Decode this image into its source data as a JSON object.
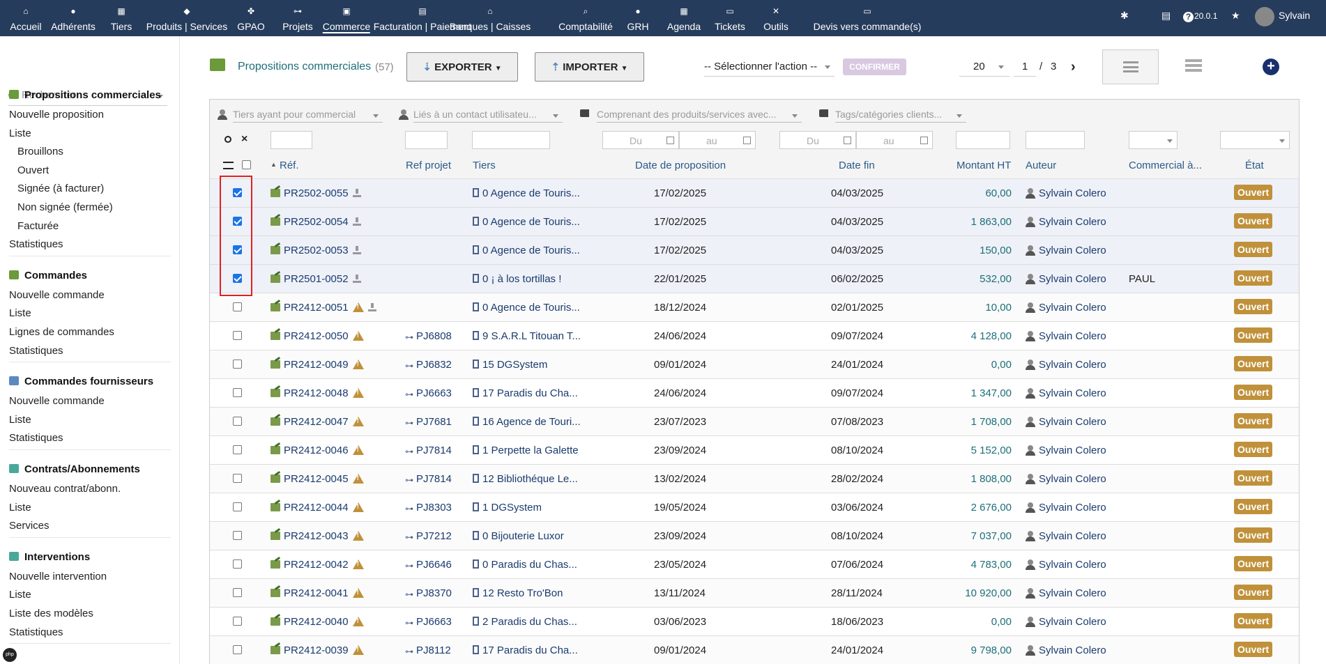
{
  "topnav": {
    "items": [
      {
        "label": "Accueil",
        "icon": "home-icon",
        "active": false
      },
      {
        "label": "Adhérents",
        "icon": "user-icon",
        "active": false
      },
      {
        "label": "Tiers",
        "icon": "building-icon",
        "active": false
      },
      {
        "label": "Produits | Services",
        "icon": "cube-icon",
        "active": false
      },
      {
        "label": "GPAO",
        "icon": "cubes-icon",
        "active": false
      },
      {
        "label": "Projets",
        "icon": "sitemap-icon",
        "active": false
      },
      {
        "label": "Commerce",
        "icon": "briefcase-icon",
        "active": true
      },
      {
        "label": "Facturation | Paiement",
        "icon": "file-invoice-icon",
        "active": false
      },
      {
        "label": "Banques | Caisses",
        "icon": "bank-icon",
        "active": false
      },
      {
        "label": "Comptabilité",
        "icon": "search-dollar-icon",
        "active": false
      },
      {
        "label": "GRH",
        "icon": "user-tie-icon",
        "active": false
      },
      {
        "label": "Agenda",
        "icon": "calendar-icon",
        "active": false
      },
      {
        "label": "Tickets",
        "icon": "ticket-icon",
        "active": false
      },
      {
        "label": "Outils",
        "icon": "tools-icon",
        "active": false
      },
      {
        "label": "Devis vers commande(s)",
        "icon": "file-icon",
        "active": false
      }
    ],
    "version": "20.0.1",
    "user": "Sylvain"
  },
  "sidebar": {
    "search_placeholder": "Rechercher",
    "sections": [
      {
        "title": "Propositions commerciales",
        "icon_color": "#6a9a3a",
        "items": [
          {
            "label": "Nouvelle proposition",
            "sub": false
          },
          {
            "label": "Liste",
            "sub": false
          },
          {
            "label": "Brouillons",
            "sub": true
          },
          {
            "label": "Ouvert",
            "sub": true
          },
          {
            "label": "Signée (à facturer)",
            "sub": true
          },
          {
            "label": "Non signée (fermée)",
            "sub": true
          },
          {
            "label": "Facturée",
            "sub": true
          },
          {
            "label": "Statistiques",
            "sub": false
          }
        ]
      },
      {
        "title": "Commandes",
        "icon_color": "#6a9a3a",
        "items": [
          {
            "label": "Nouvelle commande",
            "sub": false
          },
          {
            "label": "Liste",
            "sub": false
          },
          {
            "label": "Lignes de commandes",
            "sub": false
          },
          {
            "label": "Statistiques",
            "sub": false
          }
        ]
      },
      {
        "title": "Commandes fournisseurs",
        "icon_color": "#5a8abf",
        "items": [
          {
            "label": "Nouvelle commande",
            "sub": false
          },
          {
            "label": "Liste",
            "sub": false
          },
          {
            "label": "Statistiques",
            "sub": false
          }
        ]
      },
      {
        "title": "Contrats/Abonnements",
        "icon_color": "#4aa89a",
        "items": [
          {
            "label": "Nouveau contrat/abonn.",
            "sub": false
          },
          {
            "label": "Liste",
            "sub": false
          },
          {
            "label": "Services",
            "sub": false
          }
        ]
      },
      {
        "title": "Interventions",
        "icon_color": "#4aa89a",
        "items": [
          {
            "label": "Nouvelle intervention",
            "sub": false
          },
          {
            "label": "Liste",
            "sub": false
          },
          {
            "label": "Liste des modèles",
            "sub": false
          },
          {
            "label": "Statistiques",
            "sub": false
          }
        ]
      }
    ]
  },
  "page": {
    "title": "Propositions commerciales",
    "count": "(57)",
    "export_label": "EXPORTER",
    "import_label": "IMPORTER",
    "action_select": "-- Sélectionner l'action --",
    "confirm_label": "CONFIRMER",
    "per_page": "20",
    "page_current": "1",
    "page_sep": "/",
    "page_total": "3"
  },
  "filters": {
    "tiers_commercial": "Tiers ayant pour commercial",
    "contact": "Liés à un contact utilisateu...",
    "products": "Comprenant des produits/services avec...",
    "tags": "Tags/catégories clients...",
    "du1": "Du",
    "au1": "au",
    "du2": "Du",
    "au2": "au"
  },
  "columns": {
    "ref": "Réf.",
    "ref_projet": "Ref projet",
    "tiers": "Tiers",
    "date_prop": "Date de proposition",
    "date_fin": "Date fin",
    "montant": "Montant HT",
    "auteur": "Auteur",
    "commercial": "Commercial à...",
    "etat": "État"
  },
  "rows": [
    {
      "checked": true,
      "ref": "PR2502-0055",
      "warn": false,
      "dl": true,
      "projet": "",
      "tiers": "0 Agence de Touris...",
      "date": "17/02/2025",
      "fin": "04/03/2025",
      "montant": "60,00",
      "auteur": "Sylvain Colero",
      "commercial": "",
      "etat": "Ouvert"
    },
    {
      "checked": true,
      "ref": "PR2502-0054",
      "warn": false,
      "dl": true,
      "projet": "",
      "tiers": "0 Agence de Touris...",
      "date": "17/02/2025",
      "fin": "04/03/2025",
      "montant": "1 863,00",
      "auteur": "Sylvain Colero",
      "commercial": "",
      "etat": "Ouvert"
    },
    {
      "checked": true,
      "ref": "PR2502-0053",
      "warn": false,
      "dl": true,
      "projet": "",
      "tiers": "0 Agence de Touris...",
      "date": "17/02/2025",
      "fin": "04/03/2025",
      "montant": "150,00",
      "auteur": "Sylvain Colero",
      "commercial": "",
      "etat": "Ouvert"
    },
    {
      "checked": true,
      "ref": "PR2501-0052",
      "warn": false,
      "dl": true,
      "projet": "",
      "tiers": "0 ¡ à los tortillas !",
      "date": "22/01/2025",
      "fin": "06/02/2025",
      "montant": "532,00",
      "auteur": "Sylvain Colero",
      "commercial": "PAUL",
      "etat": "Ouvert"
    },
    {
      "checked": false,
      "ref": "PR2412-0051",
      "warn": true,
      "dl": true,
      "projet": "",
      "tiers": "0 Agence de Touris...",
      "date": "18/12/2024",
      "fin": "02/01/2025",
      "montant": "10,00",
      "auteur": "Sylvain Colero",
      "commercial": "",
      "etat": "Ouvert"
    },
    {
      "checked": false,
      "ref": "PR2412-0050",
      "warn": true,
      "dl": false,
      "projet": "PJ6808",
      "tiers": "9 S.A.R.L Titouan T...",
      "date": "24/06/2024",
      "fin": "09/07/2024",
      "montant": "4 128,00",
      "auteur": "Sylvain Colero",
      "commercial": "",
      "etat": "Ouvert"
    },
    {
      "checked": false,
      "ref": "PR2412-0049",
      "warn": true,
      "dl": false,
      "projet": "PJ6832",
      "tiers": "15 DGSystem",
      "date": "09/01/2024",
      "fin": "24/01/2024",
      "montant": "0,00",
      "auteur": "Sylvain Colero",
      "commercial": "",
      "etat": "Ouvert"
    },
    {
      "checked": false,
      "ref": "PR2412-0048",
      "warn": true,
      "dl": false,
      "projet": "PJ6663",
      "tiers": "17 Paradis du Cha...",
      "date": "24/06/2024",
      "fin": "09/07/2024",
      "montant": "1 347,00",
      "auteur": "Sylvain Colero",
      "commercial": "",
      "etat": "Ouvert"
    },
    {
      "checked": false,
      "ref": "PR2412-0047",
      "warn": true,
      "dl": false,
      "projet": "PJ7681",
      "tiers": "16 Agence de Touri...",
      "date": "23/07/2023",
      "fin": "07/08/2023",
      "montant": "1 708,00",
      "auteur": "Sylvain Colero",
      "commercial": "",
      "etat": "Ouvert"
    },
    {
      "checked": false,
      "ref": "PR2412-0046",
      "warn": true,
      "dl": false,
      "projet": "PJ7814",
      "tiers": "1 Perpette la Galette",
      "date": "23/09/2024",
      "fin": "08/10/2024",
      "montant": "5 152,00",
      "auteur": "Sylvain Colero",
      "commercial": "",
      "etat": "Ouvert"
    },
    {
      "checked": false,
      "ref": "PR2412-0045",
      "warn": true,
      "dl": false,
      "projet": "PJ7814",
      "tiers": "12 Bibliothéque Le...",
      "date": "13/02/2024",
      "fin": "28/02/2024",
      "montant": "1 808,00",
      "auteur": "Sylvain Colero",
      "commercial": "",
      "etat": "Ouvert"
    },
    {
      "checked": false,
      "ref": "PR2412-0044",
      "warn": true,
      "dl": false,
      "projet": "PJ8303",
      "tiers": "1 DGSystem",
      "date": "19/05/2024",
      "fin": "03/06/2024",
      "montant": "2 676,00",
      "auteur": "Sylvain Colero",
      "commercial": "",
      "etat": "Ouvert"
    },
    {
      "checked": false,
      "ref": "PR2412-0043",
      "warn": true,
      "dl": false,
      "projet": "PJ7212",
      "tiers": "0 Bijouterie Luxor",
      "date": "23/09/2024",
      "fin": "08/10/2024",
      "montant": "7 037,00",
      "auteur": "Sylvain Colero",
      "commercial": "",
      "etat": "Ouvert"
    },
    {
      "checked": false,
      "ref": "PR2412-0042",
      "warn": true,
      "dl": false,
      "projet": "PJ6646",
      "tiers": "0 Paradis du Chas...",
      "date": "23/05/2024",
      "fin": "07/06/2024",
      "montant": "4 783,00",
      "auteur": "Sylvain Colero",
      "commercial": "",
      "etat": "Ouvert"
    },
    {
      "checked": false,
      "ref": "PR2412-0041",
      "warn": true,
      "dl": false,
      "projet": "PJ8370",
      "tiers": "12 Resto Tro'Bon",
      "date": "13/11/2024",
      "fin": "28/11/2024",
      "montant": "10 920,00",
      "auteur": "Sylvain Colero",
      "commercial": "",
      "etat": "Ouvert"
    },
    {
      "checked": false,
      "ref": "PR2412-0040",
      "warn": true,
      "dl": false,
      "projet": "PJ6663",
      "tiers": "2 Paradis du Chas...",
      "date": "03/06/2023",
      "fin": "18/06/2023",
      "montant": "0,00",
      "auteur": "Sylvain Colero",
      "commercial": "",
      "etat": "Ouvert"
    },
    {
      "checked": false,
      "ref": "PR2412-0039",
      "warn": true,
      "dl": false,
      "projet": "PJ8112",
      "tiers": "17 Paradis du Cha...",
      "date": "09/01/2024",
      "fin": "24/01/2024",
      "montant": "9 798,00",
      "auteur": "Sylvain Colero",
      "commercial": "",
      "etat": "Ouvert"
    }
  ],
  "colors": {
    "topbar": "#263c5c",
    "badge": "#c0913a",
    "selected_row": "#eef1f8",
    "link": "#1a3b6e",
    "amount": "#1d6f78",
    "highlight": "#e02020"
  }
}
